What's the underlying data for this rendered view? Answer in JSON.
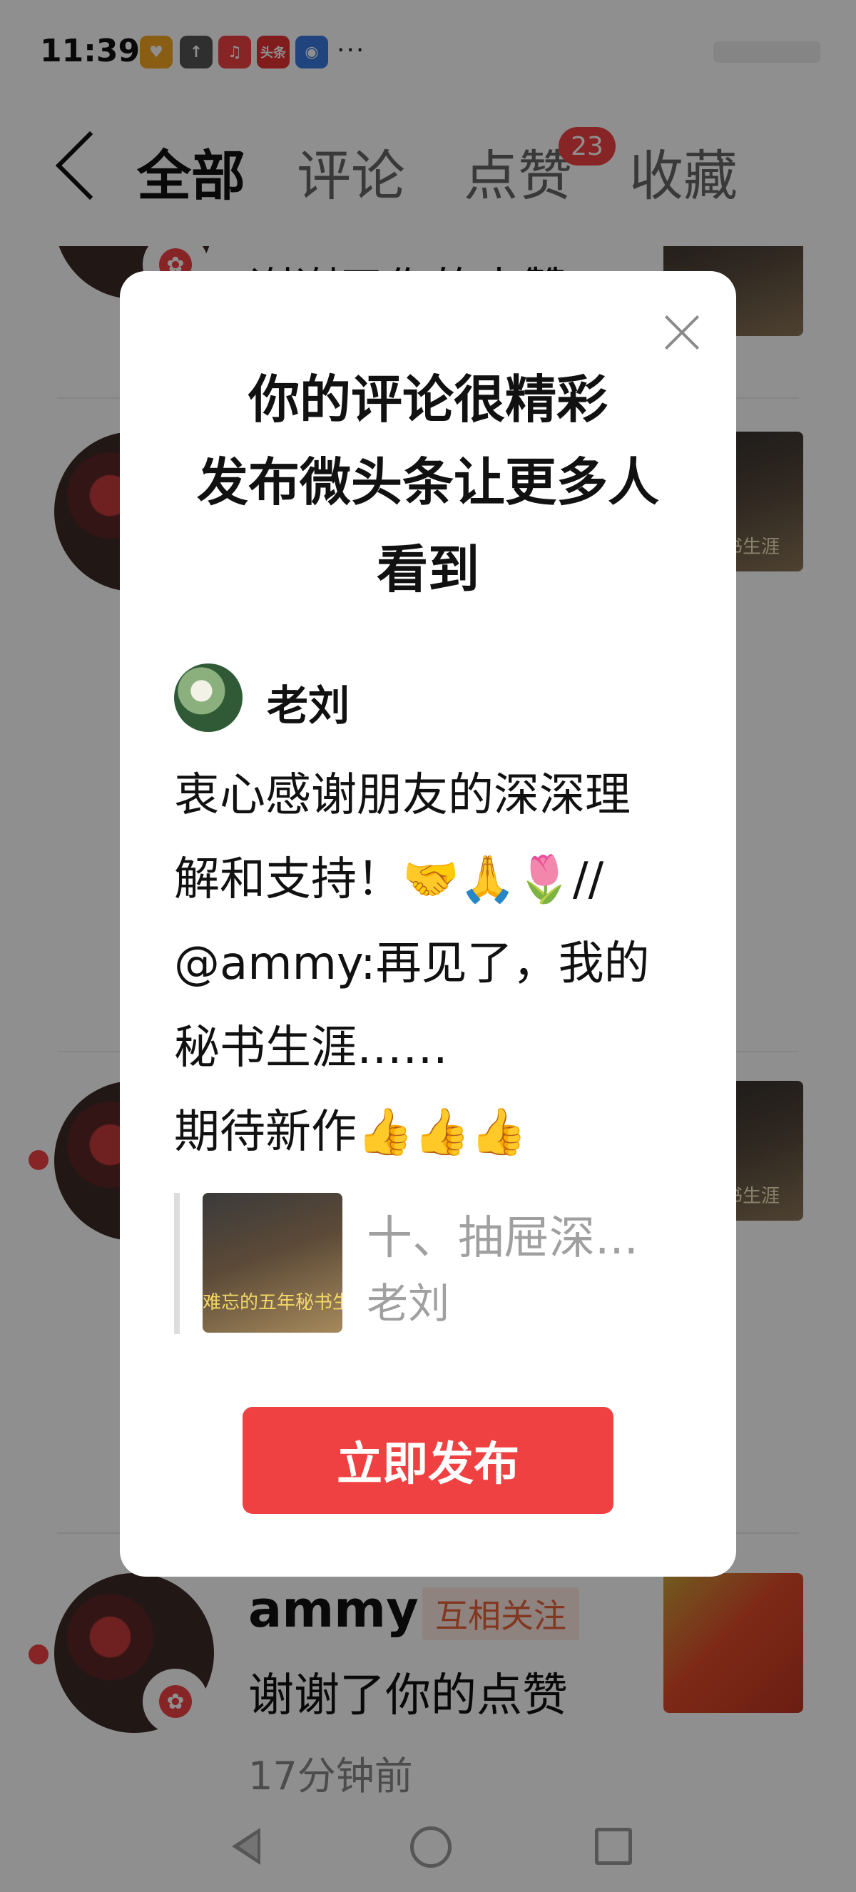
{
  "status_bar": {
    "time": "11:39",
    "app_icons": [
      {
        "name": "heart-app-icon",
        "label": "♥",
        "color": "#f5a623"
      },
      {
        "name": "upload-arrow-icon",
        "label": "↑",
        "color": "#555555"
      },
      {
        "name": "music-app-icon",
        "label": "♫",
        "color": "#f04142"
      },
      {
        "name": "toutiao-app-icon",
        "label": "头条",
        "color": "#e63232"
      },
      {
        "name": "browser-app-icon",
        "label": "◉",
        "color": "#3a7be0"
      }
    ],
    "more": "···"
  },
  "nav": {
    "tabs": [
      {
        "label": "全部",
        "active": true
      },
      {
        "label": "评论",
        "active": false
      },
      {
        "label": "点赞",
        "active": false
      },
      {
        "label": "收藏",
        "active": false
      }
    ],
    "likes_badge": "23"
  },
  "list": {
    "rows": [
      {
        "text": "谢谢了你的点赞"
      },
      {
        "name": "ammy",
        "tag": "互相关注",
        "text": "谢谢了你的点赞",
        "time": "17分钟前"
      }
    ],
    "thumb_caption": "年秘书生涯"
  },
  "modal": {
    "title_line1": "你的评论很精彩",
    "title_line2": "发布微头条让更多人",
    "title_line3": "看到",
    "author": "老刘",
    "comment": "衷心感谢朋友的深深理\n解和支持！🤝🙏🌷//\n@ammy:再见了，我的\n秘书生涯……\n期待新作👍👍👍",
    "quote": {
      "title": "十、抽屉深...",
      "author": "老刘",
      "thumb_caption": "难忘的五年秘书生涯"
    },
    "publish_label": "立即发布"
  }
}
